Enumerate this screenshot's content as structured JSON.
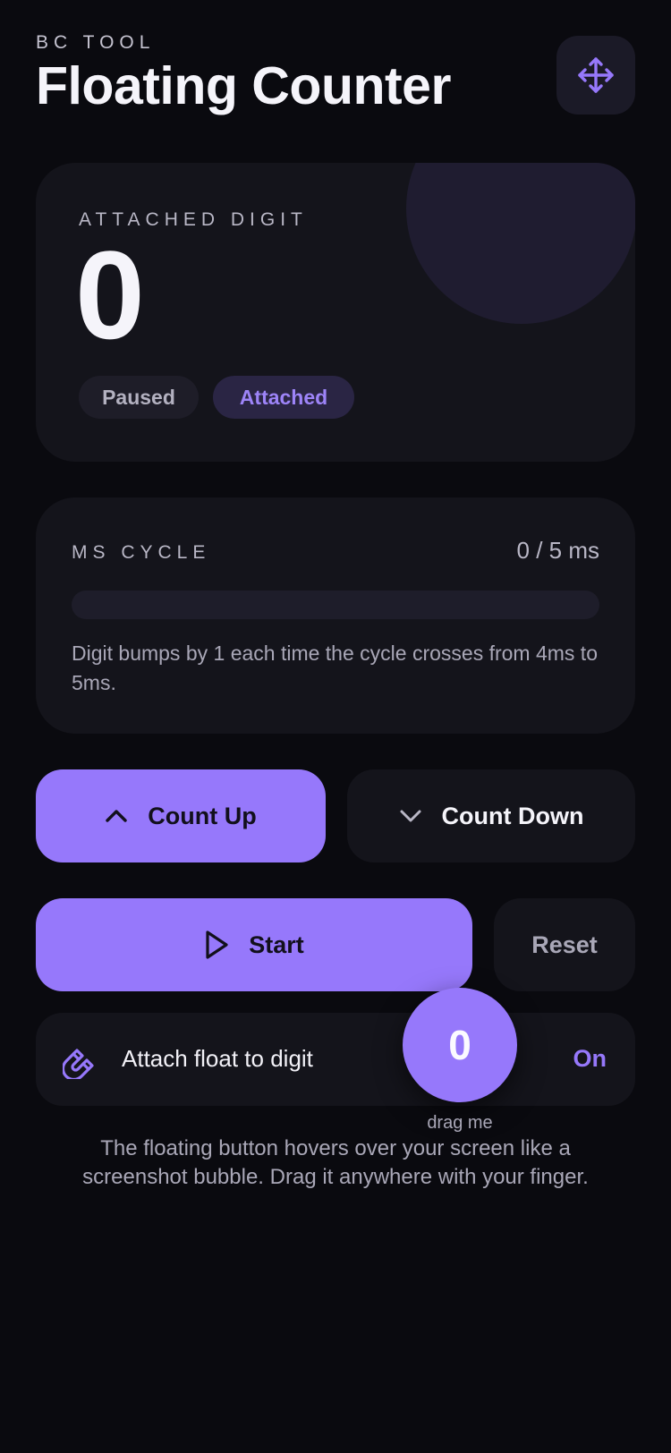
{
  "header": {
    "eyebrow": "BC TOOL",
    "title": "Floating Counter",
    "move_icon": "move-arrows-icon"
  },
  "digit_card": {
    "label": "ATTACHED DIGIT",
    "value": "0",
    "status_pill": "Paused",
    "attach_pill": "Attached"
  },
  "cycle_card": {
    "label": "MS CYCLE",
    "value": "0 / 5 ms",
    "progress": 0,
    "note": "Digit bumps by 1 each time the cycle crosses from 4ms to 5ms."
  },
  "direction": {
    "up_label": "Count Up",
    "up_icon": "chevron-up-icon",
    "down_label": "Count Down",
    "down_icon": "chevron-down-icon",
    "selected": "up"
  },
  "controls": {
    "start_label": "Start",
    "start_icon": "play-icon",
    "reset_label": "Reset"
  },
  "attach": {
    "label": "Attach float to digit",
    "icon": "magnet-icon",
    "state": "On"
  },
  "float_button": {
    "value": "0",
    "hint": "drag me"
  },
  "footnote": "The floating button hovers over your screen like a screenshot bubble. Drag it anywhere with your finger.",
  "colors": {
    "background": "#0a0a0f",
    "card": "#14141b",
    "accent": "#9678fb",
    "text": "#f5f4fa",
    "muted": "#a9a7b7"
  }
}
